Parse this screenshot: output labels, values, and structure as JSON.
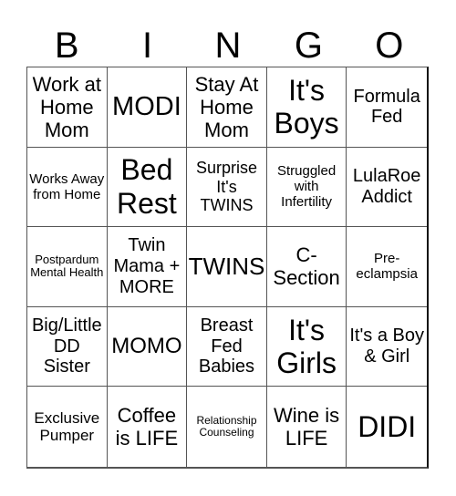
{
  "header": [
    "B",
    "I",
    "N",
    "G",
    "O"
  ],
  "cells": [
    {
      "text": "Work at Home Mom",
      "size": 22
    },
    {
      "text": "MODI",
      "size": 29
    },
    {
      "text": "Stay At Home Mom",
      "size": 22
    },
    {
      "text": "It's Boys",
      "size": 32
    },
    {
      "text": "Formula Fed",
      "size": 20
    },
    {
      "text": "Works Away from Home",
      "size": 15
    },
    {
      "text": "Bed Rest",
      "size": 32
    },
    {
      "text": "Surprise It's TWINS",
      "size": 18
    },
    {
      "text": "Struggled with Infertility",
      "size": 15
    },
    {
      "text": "LulaRoe Addict",
      "size": 20
    },
    {
      "text": "Postpardum Mental Health",
      "size": 13
    },
    {
      "text": "Twin Mama + MORE",
      "size": 20
    },
    {
      "text": "TWINS",
      "size": 26
    },
    {
      "text": "C-Section",
      "size": 22
    },
    {
      "text": "Pre-eclampsia",
      "size": 15
    },
    {
      "text": "Big/Little DD Sister",
      "size": 20
    },
    {
      "text": "MOMO",
      "size": 24
    },
    {
      "text": "Breast Fed Babies",
      "size": 20
    },
    {
      "text": "It's Girls",
      "size": 32
    },
    {
      "text": "It's a Boy & Girl",
      "size": 20
    },
    {
      "text": "Exclusive Pumper",
      "size": 17
    },
    {
      "text": "Coffee is LIFE",
      "size": 22
    },
    {
      "text": "Relationship Counseling",
      "size": 12
    },
    {
      "text": "Wine is LIFE",
      "size": 22
    },
    {
      "text": "DIDI",
      "size": 32
    }
  ]
}
